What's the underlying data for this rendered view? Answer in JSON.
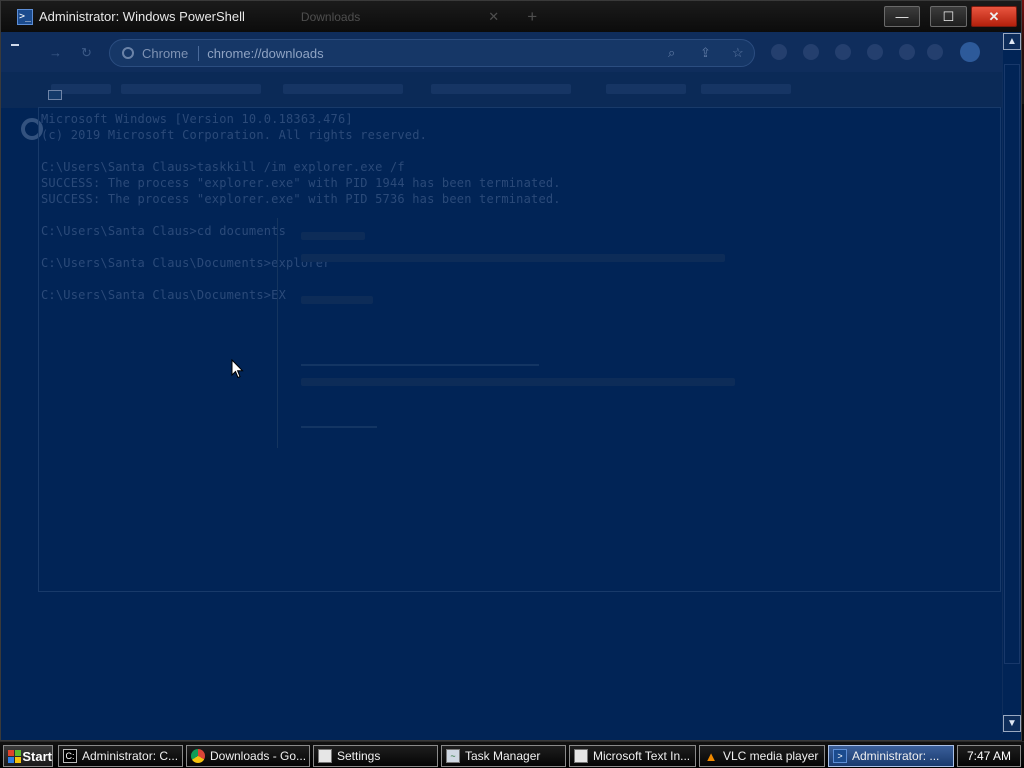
{
  "window": {
    "title": "Administrator: Windows PowerShell",
    "ghost_tab_title": "Downloads",
    "ghost_tab_close": "✕",
    "ghost_newtab": "+",
    "min_label": "—",
    "max_label": "☐",
    "close_label": "✕"
  },
  "ghost_browser": {
    "omnibox_label": "Chrome",
    "url": "chrome://downloads"
  },
  "console": {
    "lines": [
      "Microsoft Windows [Version 10.0.18363.476]",
      "(c) 2019 Microsoft Corporation. All rights reserved.",
      "",
      "C:\\Users\\Santa Claus>taskkill /im explorer.exe /f",
      "SUCCESS: The process \"explorer.exe\" with PID 1944 has been terminated.",
      "SUCCESS: The process \"explorer.exe\" with PID 5736 has been terminated.",
      "",
      "C:\\Users\\Santa Claus>cd documents",
      "",
      "C:\\Users\\Santa Claus\\Documents>explorer",
      "",
      "C:\\Users\\Santa Claus\\Documents>EX"
    ]
  },
  "scrollbar": {
    "up": "▲",
    "down": "▼"
  },
  "taskbar": {
    "start_label": "Start",
    "buttons": [
      {
        "label": "Administrator: C...",
        "icon": "cmd-icon"
      },
      {
        "label": "Downloads - Go...",
        "icon": "chrome-icon"
      },
      {
        "label": "Settings",
        "icon": "settings-icon"
      },
      {
        "label": "Task Manager",
        "icon": "task-manager-icon"
      },
      {
        "label": "Microsoft Text In...",
        "icon": "window-icon"
      },
      {
        "label": "VLC media player",
        "icon": "vlc-icon"
      },
      {
        "label": "Administrator: ...",
        "icon": "powershell-icon"
      }
    ],
    "clock": "7:47 AM"
  },
  "colors": {
    "powershell_bg": "#012456",
    "console_text": "#2b4a79",
    "close_red": "#d63a24"
  }
}
